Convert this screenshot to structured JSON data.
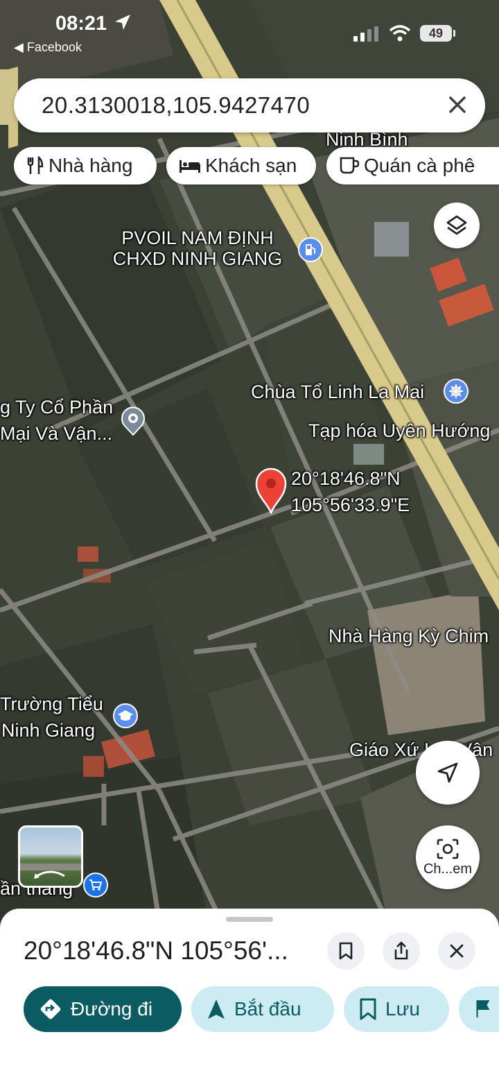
{
  "status_bar": {
    "time": "08:21",
    "back_app": "Facebook",
    "battery": "49"
  },
  "search": {
    "query": "20.3130018,105.9427470"
  },
  "chips": [
    {
      "label": "Nhà hàng",
      "icon": "restaurant-icon"
    },
    {
      "label": "Khách sạn",
      "icon": "hotel-icon"
    },
    {
      "label": "Quán cà phê",
      "icon": "cafe-icon"
    }
  ],
  "map": {
    "labels": {
      "ninh_binh": "Ninh Bình",
      "pvoil_1": "PVOIL NAM ĐỊNH",
      "pvoil_2": "CHXD NINH GIANG",
      "chua_to": "Chùa Tổ Linh La Mai",
      "tap_hoa": "Tạp hóa Uyên Hướng",
      "cong_ty_1": "g Ty Cổ Phần",
      "cong_ty_2": "Mại Và Vận...",
      "pin_lat": "20°18'46.8\"N",
      "pin_lng": "105°56'33.9\"E",
      "nha_hang": "Nhà Hàng Kỳ Chim",
      "truong_1": "Trường Tiểu",
      "truong_2": "Ninh Giang",
      "giao_xu": "Giáo Xứ Lạc Vân",
      "an_thang": "ần thắng"
    },
    "lens_label": "Ch...em"
  },
  "sheet": {
    "title": "20°18'46.8\"N 105°56'...",
    "actions": [
      {
        "label": "Đường đi",
        "icon": "directions-icon",
        "style": "primary"
      },
      {
        "label": "Bắt đầu",
        "icon": "navigation-icon",
        "style": "secondary"
      },
      {
        "label": "Lưu",
        "icon": "bookmark-icon",
        "style": "secondary"
      },
      {
        "label": "",
        "icon": "flag-icon",
        "style": "secondary"
      }
    ]
  },
  "colors": {
    "accent_dark": "#0b5c62",
    "accent_light": "#cdebf3",
    "pin": "#ea4335",
    "poi_blue": "#5b8def"
  }
}
